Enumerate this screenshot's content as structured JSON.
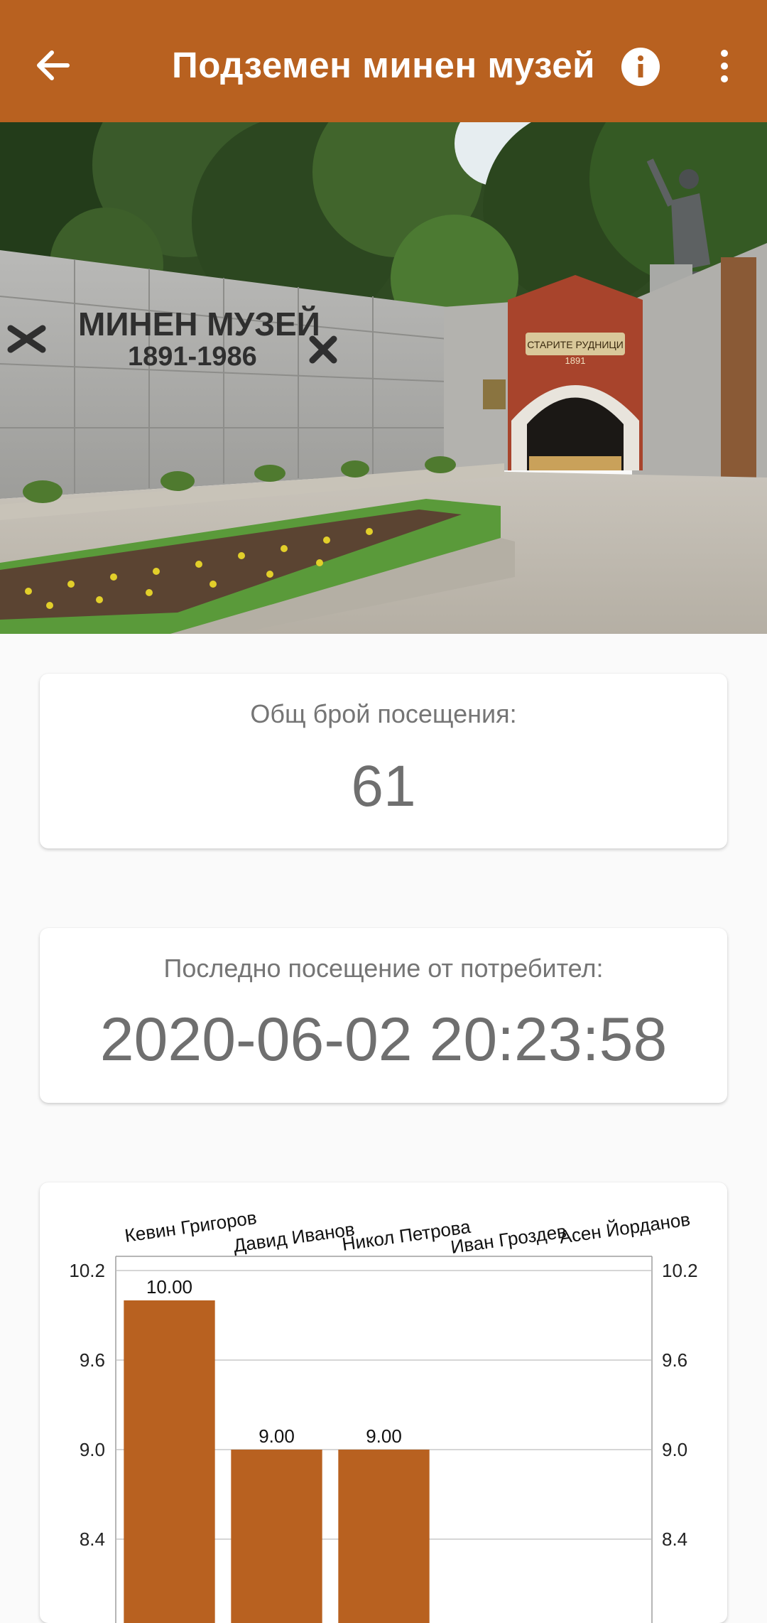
{
  "app_bar": {
    "title": "Подземен минен музей",
    "back_icon": "arrow-back-icon",
    "info_icon": "info-icon",
    "more_icon": "more-vert-icon",
    "color": "#b86120"
  },
  "hero": {
    "sign_line1": "МИНЕН МУЗЕЙ",
    "sign_line2": "1891-1986",
    "arch_line1": "СТАРИТЕ РУДНИЦИ",
    "arch_line2": "1891"
  },
  "visits": {
    "label": "Общ брой посещения:",
    "value": "61"
  },
  "last_visit": {
    "label": "Последно посещение от потребител:",
    "value": "2020-06-02 20:23:58"
  },
  "chart_data": {
    "type": "bar",
    "categories": [
      "Кевин Григоров",
      "Давид Иванов",
      "Никол Петрова",
      "Иван Гроздев",
      "Асен Йорданов"
    ],
    "values": [
      10.0,
      9.0,
      9.0,
      null,
      null
    ],
    "value_labels": [
      "10.00",
      "9.00",
      "9.00",
      "",
      ""
    ],
    "yticks": [
      "10.2",
      "9.6",
      "9.0",
      "8.4"
    ],
    "ylim_visible": [
      8.4,
      10.2
    ],
    "axis_right": true,
    "grid": true,
    "bar_color": "#b86120"
  }
}
